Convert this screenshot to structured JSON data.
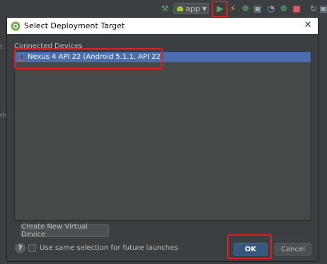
{
  "toolbar": {
    "run_configuration": "app",
    "icons": [
      "hammer-icon",
      "android-icon",
      "run-icon",
      "instant-run-icon",
      "debug-icon",
      "coverage-icon",
      "profile-icon",
      "attach-debugger-icon",
      "stop-icon",
      "sync-icon"
    ]
  },
  "background": {
    "edge_text_1": "t",
    "edge_text_2": "th"
  },
  "dialog": {
    "title": "Select Deployment Target",
    "section_label": "Connected Devices",
    "devices": [
      {
        "name": "Nexus 4 API 22 (Android 5.1.1, API 22)"
      }
    ],
    "create_button": "Create New Virtual Device",
    "help_label": "?",
    "checkbox_label": "Use same selection for future launches",
    "checkbox_checked": false,
    "ok_button": "OK",
    "cancel_button": "Cancel"
  },
  "colors": {
    "highlight_frame": "#e0201c",
    "selection": "#4b6eaf",
    "dialog_bg": "#3c3f41",
    "ok_button": "#365880"
  }
}
